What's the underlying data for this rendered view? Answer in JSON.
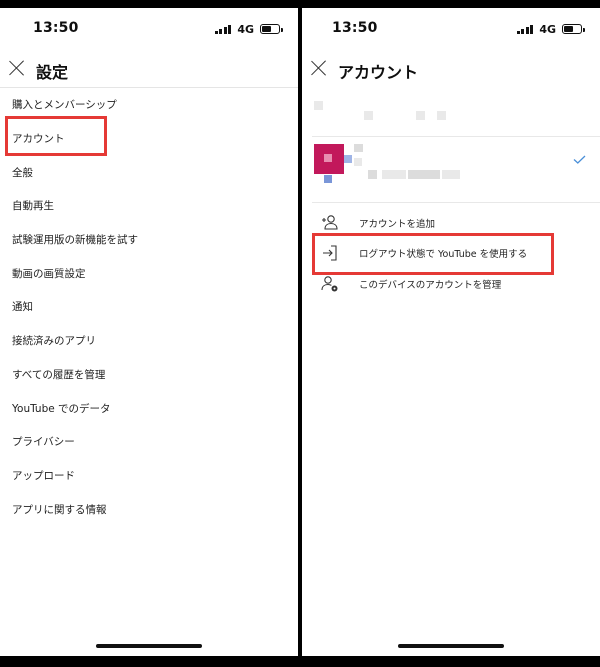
{
  "left": {
    "status": {
      "time": "13:50",
      "network": "4G"
    },
    "header": {
      "title": "設定"
    },
    "menu": [
      "購入とメンバーシップ",
      "アカウント",
      "全般",
      "自動再生",
      "試験運用版の新機能を試す",
      "動画の画質設定",
      "通知",
      "接続済みのアプリ",
      "すべての履歴を管理",
      "YouTube でのデータ",
      "プライバシー",
      "アップロード",
      "アプリに関する情報"
    ]
  },
  "right": {
    "status": {
      "time": "13:50",
      "network": "4G"
    },
    "header": {
      "title": "アカウント"
    },
    "actions": {
      "add_account": "アカウントを追加",
      "use_signed_out": "ログアウト状態で YouTube を使用する",
      "manage_accounts": "このデバイスのアカウントを管理"
    }
  },
  "colors": {
    "highlight": "#e53935",
    "avatar": "#c2185b",
    "check": "#4a8fd8"
  }
}
